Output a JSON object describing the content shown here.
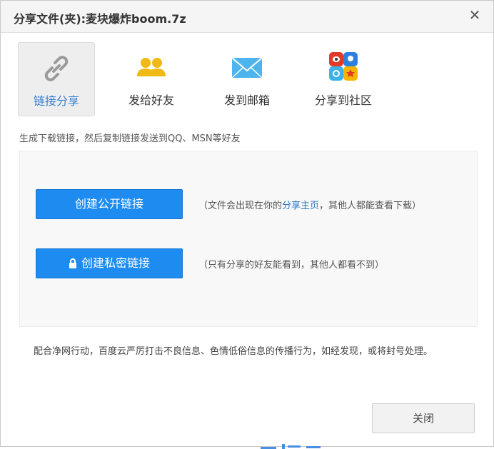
{
  "dialog": {
    "title": "分享文件(夹):麦块爆炸boom.7z",
    "close_icon": "close-icon"
  },
  "tabs": [
    {
      "label": "链接分享",
      "icon": "link-icon",
      "active": true
    },
    {
      "label": "发给好友",
      "icon": "friends-icon",
      "active": false
    },
    {
      "label": "发到邮箱",
      "icon": "mail-icon",
      "active": false
    },
    {
      "label": "分享到社区",
      "icon": "community-icon",
      "active": false
    }
  ],
  "description": "生成下载链接，然后复制链接发送到QQ、MSN等好友",
  "public_link": {
    "button": "创建公开链接",
    "note_before": "（文件会出现在你的",
    "note_link": "分享主页",
    "note_after": "，其他人都能查看下载）"
  },
  "private_link": {
    "button": "创建私密链接",
    "icon": "lock-icon",
    "note": "（只有分享的好友能看到，其他人都看不到）"
  },
  "notice": "配合净网行动，百度云严厉打击不良信息、色情低俗信息的传播行为，如经发现，或将封号处理。",
  "footer": {
    "close_button": "关闭"
  },
  "colors": {
    "primary_button": "#1d8bef",
    "link_text": "#2a73c4",
    "active_tab_label": "#3a7fd0",
    "friends_icon": "#f0b915",
    "mail_icon": "#4db4ee"
  }
}
